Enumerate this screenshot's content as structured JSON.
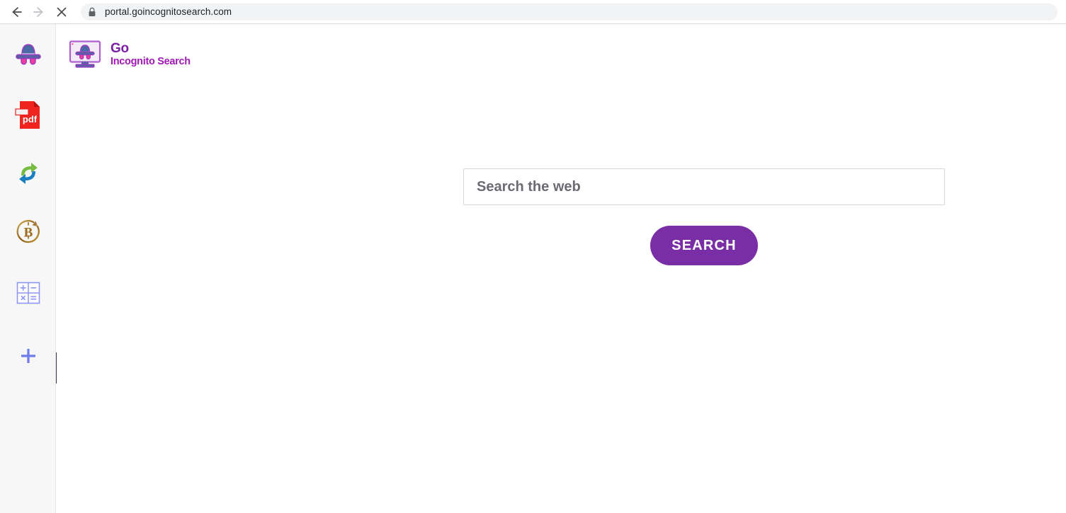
{
  "browser": {
    "back_label": "Back",
    "forward_label": "Forward",
    "stop_label": "Stop loading",
    "lock_label": "Connection is secure",
    "url": "portal.goincognitosearch.com"
  },
  "sidebar": {
    "items": [
      {
        "name": "incognito-search",
        "label": "Go Incognito Search",
        "icon": "incognito-hat-icon"
      },
      {
        "name": "pdf-tool",
        "label": "PDF",
        "icon": "pdf-file-icon",
        "text": "pdf"
      },
      {
        "name": "file-converter",
        "label": "Converter",
        "icon": "convert-arrows-icon"
      },
      {
        "name": "bitcoin-tool",
        "label": "Bitcoin",
        "icon": "bitcoin-icon",
        "text": "B"
      },
      {
        "name": "calculator-tool",
        "label": "Calculator",
        "icon": "calculator-icon",
        "keys": [
          "+",
          "−",
          "×",
          "="
        ]
      },
      {
        "name": "add-extension",
        "label": "Add",
        "icon": "plus-icon"
      }
    ],
    "collapse_label": "Collapse sidebar",
    "collapse_icon": "chevron-left-icon"
  },
  "page": {
    "logo": {
      "icon": "incognito-monitor-icon",
      "line1": "Go",
      "line2": "Incognito Search"
    },
    "search": {
      "placeholder": "Search the web",
      "value": "",
      "button_label": "SEARCH"
    }
  },
  "colors": {
    "brand_purple": "#7a2ea6",
    "brand_magenta": "#a019b5",
    "logo_dark_purple": "#7b1fa2",
    "sidebar_bg": "#f7f7f7",
    "handle_dark": "#3b3647",
    "pdf_red": "#f0241f",
    "convert_green": "#76bc43",
    "convert_blue": "#1a7fc1",
    "bitcoin_gold": "#9a6b1d",
    "calculator_blue": "#8c96f5",
    "plus_blue": "#6f7cf0"
  }
}
